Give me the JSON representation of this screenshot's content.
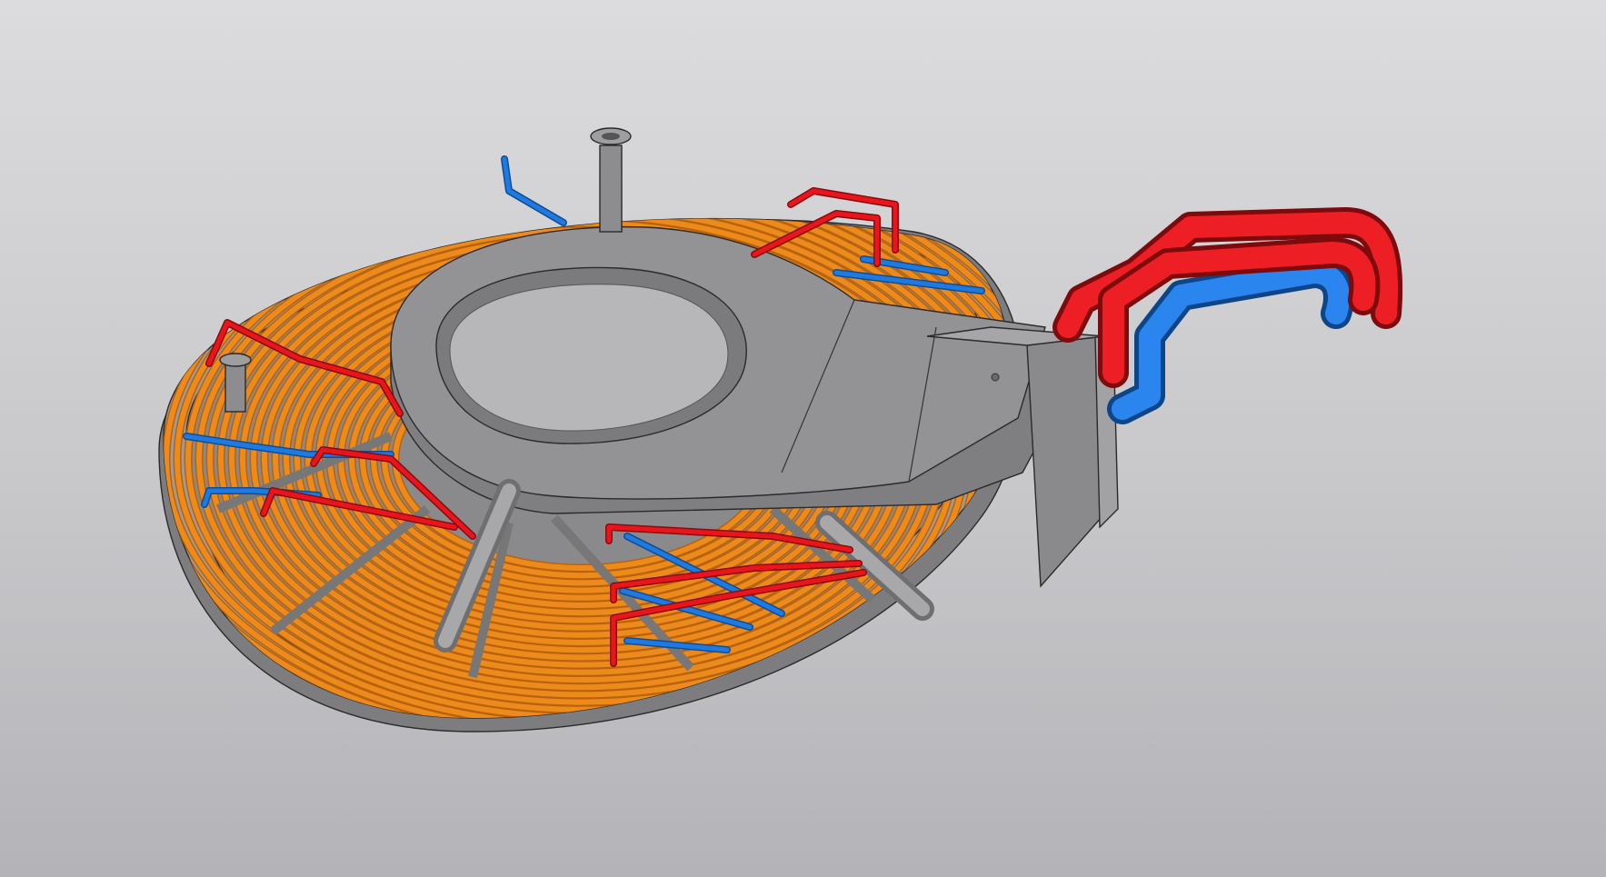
{
  "viewport": {
    "background_top": "#dcdcde",
    "background_bottom": "#b4b4b8"
  },
  "model": {
    "steel_color": "#8f8f91",
    "steel_light": "#a9a9ab",
    "steel_dark": "#6d6d70",
    "coil_color": "#ec8a1c",
    "coil_dark": "#b8620c",
    "hot_pipe_color": "#e8161c",
    "cold_pipe_color": "#1f7ae0"
  }
}
